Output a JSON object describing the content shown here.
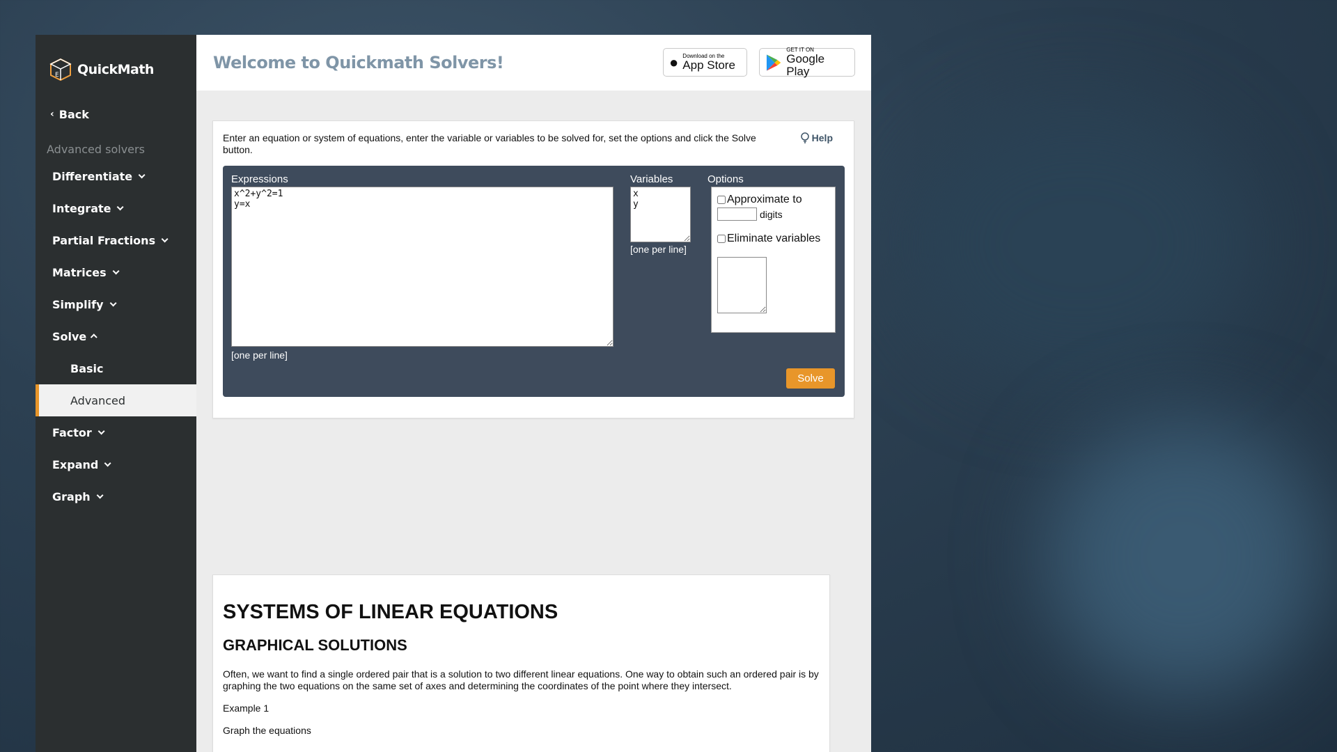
{
  "brand": {
    "name": "QuickMath"
  },
  "sidebar": {
    "back_label": "Back",
    "section_label": "Advanced solvers",
    "items": [
      {
        "label": "Differentiate",
        "expanded": false
      },
      {
        "label": "Integrate",
        "expanded": false
      },
      {
        "label": "Partial Fractions",
        "expanded": false
      },
      {
        "label": "Matrices",
        "expanded": false
      },
      {
        "label": "Simplify",
        "expanded": false
      },
      {
        "label": "Solve",
        "expanded": true,
        "subitems": [
          {
            "label": "Basic",
            "active": false
          },
          {
            "label": "Advanced",
            "active": true
          }
        ]
      },
      {
        "label": "Factor",
        "expanded": false
      },
      {
        "label": "Expand",
        "expanded": false
      },
      {
        "label": "Graph",
        "expanded": false
      }
    ]
  },
  "header": {
    "title": "Welcome to Quickmath Solvers!",
    "app_store": {
      "small": "Download on the",
      "big": "App Store"
    },
    "google_play": {
      "small": "GET IT ON",
      "big": "Google Play"
    }
  },
  "solver": {
    "intro": "Enter an equation or system of equations, enter the variable or variables to be solved for, set the options and click the Solve button.",
    "help_label": "Help",
    "expressions_label": "Expressions",
    "expressions_value": "x^2+y^2=1\ny=x",
    "expressions_note": "[one per line]",
    "variables_label": "Variables",
    "variables_value": "x\ny",
    "variables_note": "[one per line]",
    "options_label": "Options",
    "approximate_label": "Approximate to",
    "digits_label": "digits",
    "digits_value": "",
    "eliminate_label": "Eliminate variables",
    "eliminate_value": "",
    "solve_label": "Solve"
  },
  "article": {
    "heading": "SYSTEMS OF LINEAR EQUATIONS",
    "subheading": "GRAPHICAL SOLUTIONS",
    "paragraph": "Often, we want to find a single ordered pair that is a solution to two different linear equations. One way to obtain such an ordered pair is by graphing the two equations on the same set of axes and determining the coordinates of the point where they intersect.",
    "example": "Example 1",
    "instruction": "Graph the equations"
  },
  "colors": {
    "accent": "#e8962a",
    "sidebar": "#2b2f30",
    "panel": "#3e4b5c",
    "title": "#7f95a7"
  }
}
